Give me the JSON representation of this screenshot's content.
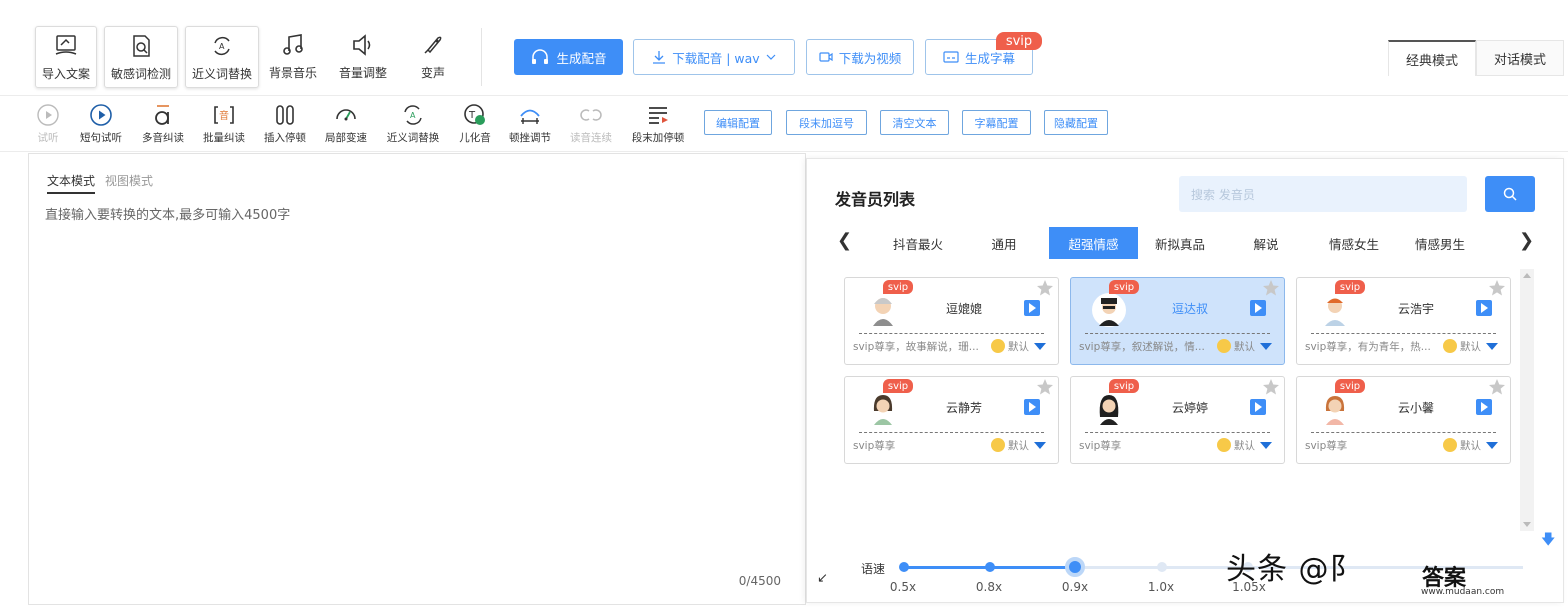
{
  "toolbar_top": {
    "tools": [
      {
        "label": "导入文案",
        "icon": "import-doc-icon"
      },
      {
        "label": "敏感词检测",
        "icon": "sensitive-check-icon"
      },
      {
        "label": "近义词替换",
        "icon": "synonym-replace-icon"
      },
      {
        "label": "背景音乐",
        "icon": "music-note-icon"
      },
      {
        "label": "音量调整",
        "icon": "speaker-icon"
      },
      {
        "label": "变声",
        "icon": "voice-change-icon"
      }
    ],
    "generate_label": "生成配音",
    "download_label": "下载配音 | wav",
    "download_video_label": "下载为视频",
    "subtitle_label": "生成字幕",
    "subtitle_badge": "svip",
    "modes": [
      "经典模式",
      "对话模式"
    ],
    "accent": "#3e8ef7"
  },
  "toolbar_second": {
    "tools": [
      {
        "label": "试听",
        "icon": "play-outline-icon",
        "disabled": true
      },
      {
        "label": "短句试听",
        "icon": "play-circle-icon",
        "disabled": false
      },
      {
        "label": "多音纠读",
        "icon": "polyphone-icon",
        "disabled": false
      },
      {
        "label": "批量纠读",
        "icon": "batch-correct-icon",
        "disabled": false
      },
      {
        "label": "插入停顿",
        "icon": "pause-insert-icon",
        "disabled": false
      },
      {
        "label": "局部变速",
        "icon": "speedometer-icon",
        "disabled": false
      },
      {
        "label": "近义词替换",
        "icon": "synonym-icon",
        "disabled": false
      },
      {
        "label": "儿化音",
        "icon": "erhua-icon",
        "disabled": false
      },
      {
        "label": "顿挫调节",
        "icon": "cadence-icon",
        "disabled": false
      },
      {
        "label": "读音连续",
        "icon": "link-icon",
        "disabled": true
      },
      {
        "label": "段末加停顿",
        "icon": "paragraph-pause-icon",
        "disabled": false
      }
    ],
    "pills": [
      "编辑配置",
      "段末加逗号",
      "清空文本",
      "字幕配置",
      "隐藏配置"
    ]
  },
  "editor": {
    "tabs": [
      "文本模式",
      "视图模式"
    ],
    "placeholder": "直接输入要转换的文本,最多可输入4500字",
    "count": "0/4500"
  },
  "speaker_panel": {
    "title": "发音员列表",
    "search_placeholder": "搜索 发音员",
    "categories": [
      "抖音最火",
      "通用",
      "超强情感",
      "新拟真品",
      "解说",
      "情感女生",
      "情感男生"
    ],
    "active_category": "超强情感",
    "speakers": [
      {
        "name": "逗媲媲",
        "badge": "svip",
        "desc": "svip尊享，故事解说，珊...",
        "style": "默认",
        "selected": false
      },
      {
        "name": "逗达叔",
        "badge": "svip",
        "desc": "svip尊享，叙述解说，情...",
        "style": "默认",
        "selected": true
      },
      {
        "name": "云浩宇",
        "badge": "svip",
        "desc": "svip尊享，有为青年，热...",
        "style": "默认",
        "selected": false
      },
      {
        "name": "云静芳",
        "badge": "svip",
        "desc": "svip尊享",
        "style": "默认",
        "selected": false
      },
      {
        "name": "云婷婷",
        "badge": "svip",
        "desc": "svip尊享",
        "style": "默认",
        "selected": false
      },
      {
        "name": "云小馨",
        "badge": "svip",
        "desc": "svip尊享",
        "style": "默认",
        "selected": false
      }
    ],
    "speed": {
      "label": "语速",
      "ticks": [
        "0.5x",
        "0.8x",
        "0.9x",
        "1.0x",
        "1.05x"
      ],
      "current": "0.9x"
    }
  },
  "watermark": {
    "text": "头条 @阝",
    "brand": "答案",
    "url": "www.mudaan.com"
  }
}
